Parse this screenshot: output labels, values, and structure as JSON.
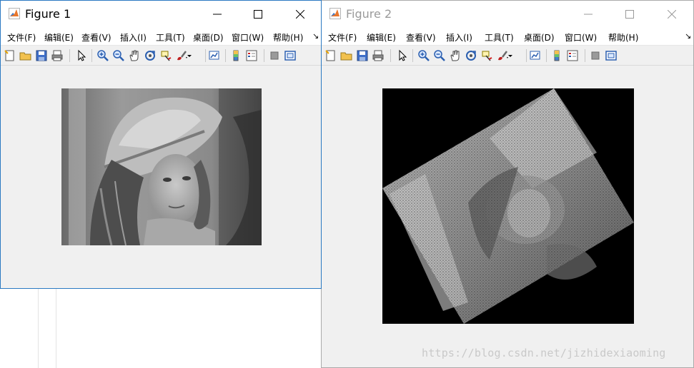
{
  "figure1": {
    "title": "Figure 1",
    "menu": [
      "文件(F)",
      "编辑(E)",
      "查看(V)",
      "插入(I)",
      "工具(T)",
      "桌面(D)",
      "窗口(W)",
      "帮助(H)"
    ]
  },
  "figure2": {
    "title": "Figure 2",
    "menu": [
      "文件(F)",
      "编辑(E)",
      "查看(V)",
      "插入(I)",
      "工具(T)",
      "桌面(D)",
      "窗口(W)",
      "帮助(H)"
    ]
  },
  "toolbar_icons": [
    "new-figure-icon",
    "open-file-icon",
    "save-icon",
    "print-icon",
    "pointer-icon",
    "zoom-in-icon",
    "zoom-out-icon",
    "pan-icon",
    "rotate-3d-icon",
    "data-cursor-icon",
    "brush-icon",
    "link-plot-icon",
    "colorbar-icon",
    "legend-icon",
    "hide-plot-tools-icon",
    "show-plot-tools-icon"
  ],
  "colors": {
    "active_border": "#2b79c2",
    "matlab_orange": "#e8762c",
    "matlab_blue": "#3f7fd0"
  },
  "watermark": "https://blog.csdn.net/jizhidexiaoming"
}
